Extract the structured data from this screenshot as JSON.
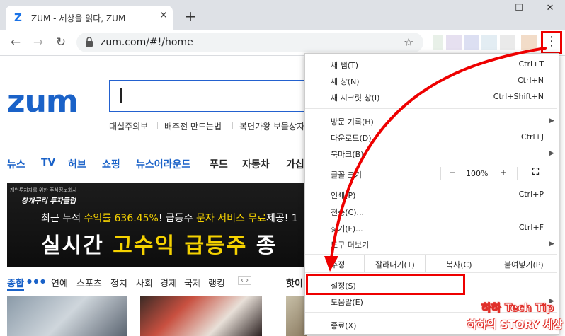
{
  "colors": {
    "accent": "#1a62c8",
    "highlight": "#e00000"
  },
  "browser": {
    "tab_title": "ZUM - 세상을 읽다, ZUM",
    "tab_favicon": "Z",
    "url": "zum.com/#!/home"
  },
  "page": {
    "logo": "zum",
    "keywords": [
      "대설주의보",
      "배추전 만드는법",
      "복면가왕 보물상자"
    ],
    "nav": [
      "뉴스",
      "TV",
      "허브",
      "쇼핑",
      "뉴스어라운드",
      "푸드",
      "자동차",
      "가십"
    ],
    "banner": {
      "sub": "개인투자자를 위한 주식정보회사",
      "brand": "창개구리 투자클럽",
      "line1_a": "최근 누적",
      "line1_b": "수익률 636.45%",
      "line1_c": "! 급등주",
      "line1_d": "문자 서비스 무료",
      "line1_e": "제공! 1",
      "line2_a": "실시간",
      "line2_b": "고수익 급등주",
      "line2_c": "종"
    },
    "categories": [
      "종합",
      "연예",
      "스포츠",
      "정치",
      "사회",
      "경제",
      "국제",
      "랭킹"
    ],
    "more_label": "핫이"
  },
  "menu": {
    "new_tab": {
      "label": "새 탭(T)",
      "shortcut": "Ctrl+T"
    },
    "new_window": {
      "label": "새 창(N)",
      "shortcut": "Ctrl+N"
    },
    "incognito": {
      "label": "새 시크릿 창(I)",
      "shortcut": "Ctrl+Shift+N"
    },
    "history": {
      "label": "방문 기록(H)"
    },
    "downloads": {
      "label": "다운로드(D)",
      "shortcut": "Ctrl+J"
    },
    "bookmarks": {
      "label": "북마크(B)"
    },
    "zoom": {
      "label": "글꼴 크기",
      "minus": "−",
      "value": "100%",
      "plus": "+"
    },
    "print": {
      "label": "인쇄(P)",
      "shortcut": "Ctrl+P"
    },
    "cast": {
      "label": "전송(C)..."
    },
    "find": {
      "label": "찾기(F)...",
      "shortcut": "Ctrl+F"
    },
    "more_tools": {
      "label": "도구 더보기"
    },
    "edit": {
      "label": "수정",
      "cut": "잘라내기(T)",
      "copy": "복사(C)",
      "paste": "붙여넣기(P)"
    },
    "settings": {
      "label": "설정(S)"
    },
    "help": {
      "label": "도움말(E)"
    },
    "exit": {
      "label": "종료(X)"
    }
  },
  "watermark": {
    "line1": "하하 Tech Tip",
    "line2": "하하의 STORY 세상"
  }
}
